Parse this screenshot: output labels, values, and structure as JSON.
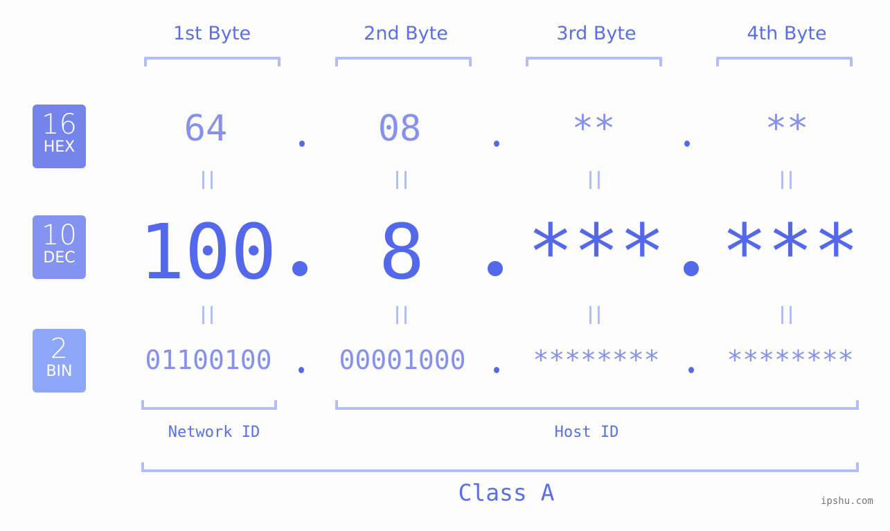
{
  "byte_headers": [
    "1st Byte",
    "2nd Byte",
    "3rd Byte",
    "4th Byte"
  ],
  "badges": {
    "hex": {
      "number": "16",
      "label": "HEX",
      "color": "#7584ea"
    },
    "dec": {
      "number": "10",
      "label": "DEC",
      "color": "#8493f0"
    },
    "bin": {
      "number": "2",
      "label": "BIN",
      "color": "#8ea7fb"
    }
  },
  "hex": [
    "64",
    "08",
    "**",
    "**"
  ],
  "dec": [
    "100",
    "8",
    "***",
    "***"
  ],
  "bin": [
    "01100100",
    "00001000",
    "********",
    "********"
  ],
  "separator": ".",
  "equals": "=",
  "segments": {
    "network": "Network ID",
    "host": "Host ID"
  },
  "ip_class": "Class A",
  "watermark": "ipshu.com",
  "colors": {
    "accent": "#5368ea",
    "light_value": "#8591ec",
    "bracket": "#b3bdf8"
  }
}
